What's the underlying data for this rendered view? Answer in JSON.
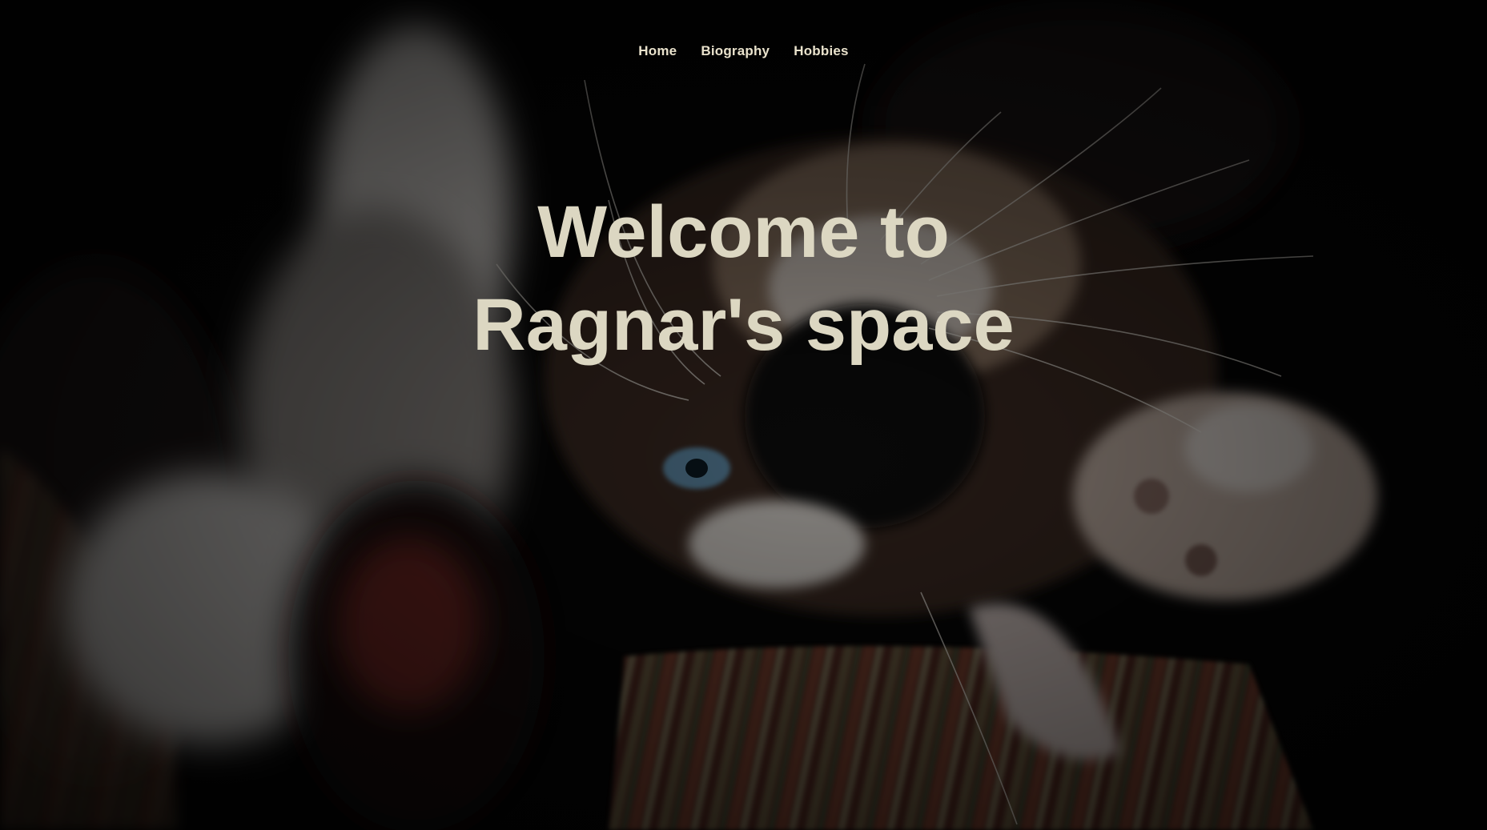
{
  "nav": {
    "items": [
      {
        "label": "Home"
      },
      {
        "label": "Biography"
      },
      {
        "label": "Hobbies"
      }
    ]
  },
  "hero": {
    "title_line1": "Welcome to",
    "title_line2": "Ragnar's space",
    "background_image": "kitten-photo"
  },
  "colors": {
    "nav_text": "#e9e2cc",
    "title_text": "#dcd7c2",
    "background": "#050505"
  }
}
